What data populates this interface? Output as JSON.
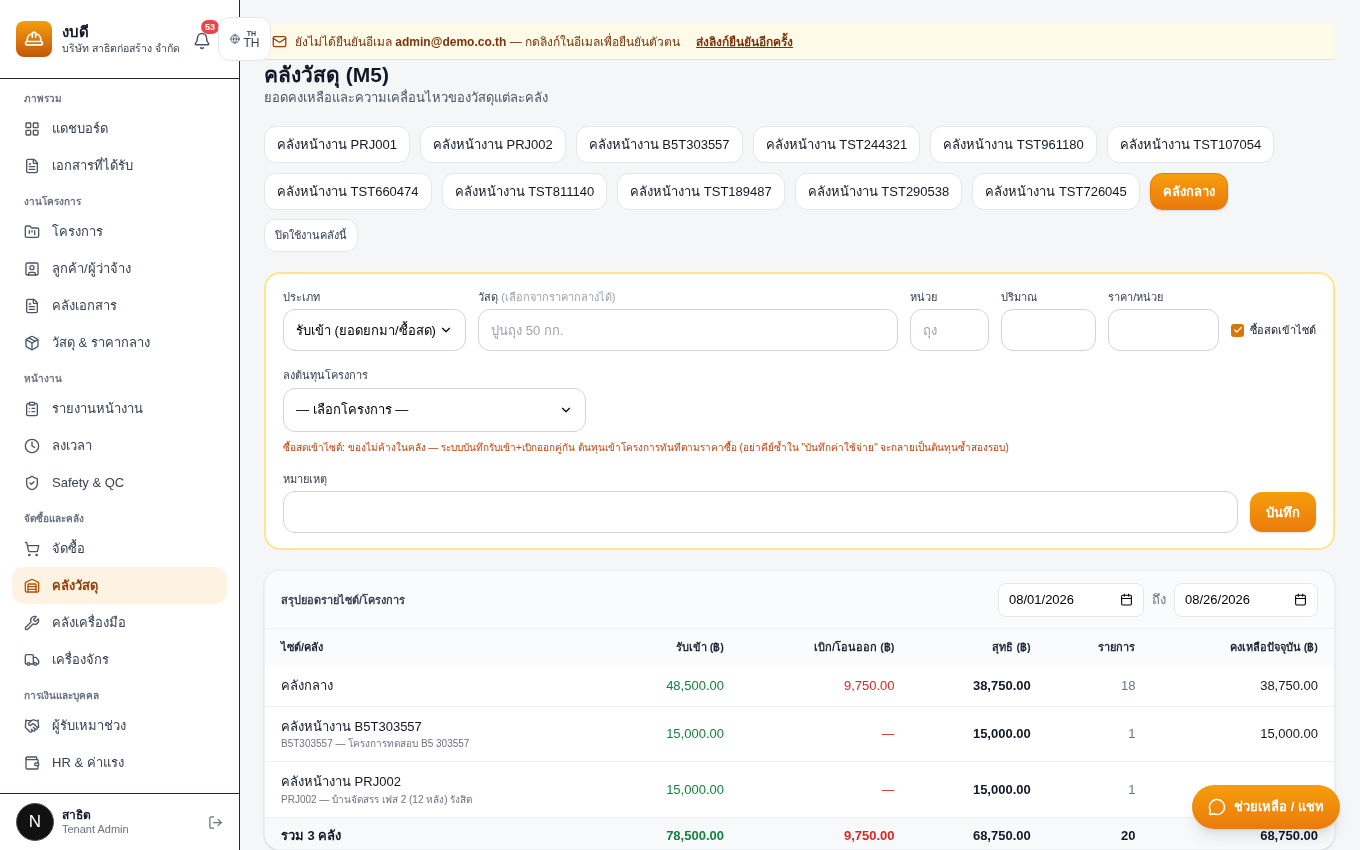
{
  "brand": {
    "name": "งบดี",
    "company": "บริษัท สาธิตก่อสร้าง จำกัด"
  },
  "notifications": {
    "count": "53"
  },
  "language": {
    "small": "TH",
    "label": "TH"
  },
  "sidebar": {
    "sections": [
      {
        "title": "ภาพรวม",
        "items": [
          {
            "label": "แดชบอร์ด",
            "selected": false
          },
          {
            "label": "เอกสารที่ได้รับ",
            "selected": false
          }
        ]
      },
      {
        "title": "งานโครงการ",
        "items": [
          {
            "label": "โครงการ",
            "selected": false
          },
          {
            "label": "ลูกค้า/ผู้ว่าจ้าง",
            "selected": false
          },
          {
            "label": "คลังเอกสาร",
            "selected": false
          },
          {
            "label": "วัสดุ & ราคากลาง",
            "selected": false
          }
        ]
      },
      {
        "title": "หน้างาน",
        "items": [
          {
            "label": "รายงานหน้างาน",
            "selected": false
          },
          {
            "label": "ลงเวลา",
            "selected": false
          },
          {
            "label": "Safety & QC",
            "selected": false
          }
        ]
      },
      {
        "title": "จัดซื้อและคลัง",
        "items": [
          {
            "label": "จัดซื้อ",
            "selected": false
          },
          {
            "label": "คลังวัสดุ",
            "selected": true
          },
          {
            "label": "คลังเครื่องมือ",
            "selected": false
          },
          {
            "label": "เครื่องจักร",
            "selected": false
          }
        ]
      },
      {
        "title": "การเงินและบุคคล",
        "items": [
          {
            "label": "ผู้รับเหมาช่วง",
            "selected": false
          },
          {
            "label": "HR & ค่าแรง",
            "selected": false
          }
        ]
      }
    ],
    "user": {
      "avatar": "N",
      "name": "สาธิต",
      "role": "Tenant Admin"
    }
  },
  "banner": {
    "text": "ยังไม่ได้ยืนยันอีเมล **admin@demo.co.th** — กดลิงก์ในอีเมลเพื่อยืนยันตัวตน",
    "link": "ส่งลิงก์ยืนยันอีกครั้ง"
  },
  "page": {
    "title": "คลังวัสดุ (M5)",
    "subtitle": "ยอดคงเหลือและความเคลื่อนไหวของวัสดุแต่ละคลัง"
  },
  "warehouses": [
    {
      "label": "คลังหน้างาน PRJ001",
      "selected": false
    },
    {
      "label": "คลังหน้างาน PRJ002",
      "selected": false
    },
    {
      "label": "คลังหน้างาน B5T303557",
      "selected": false
    },
    {
      "label": "คลังหน้างาน TST244321",
      "selected": false
    },
    {
      "label": "คลังหน้างาน TST961180",
      "selected": false
    },
    {
      "label": "คลังหน้างาน TST107054",
      "selected": false
    },
    {
      "label": "คลังหน้างาน TST660474",
      "selected": false
    },
    {
      "label": "คลังหน้างาน TST811140",
      "selected": false
    },
    {
      "label": "คลังหน้างาน TST189487",
      "selected": false
    },
    {
      "label": "คลังหน้างาน TST290538",
      "selected": false
    },
    {
      "label": "คลังหน้างาน TST726045",
      "selected": false
    },
    {
      "label": "คลังกลาง",
      "selected": true
    }
  ],
  "disable_button": "ปิดใช้งานคลังนี้",
  "form": {
    "type": {
      "label": "ประเภท",
      "value": "รับเข้า (ยอดยกมา/ซื้อสด)"
    },
    "material": {
      "label": "วัสดุ",
      "hint": "(เลือกจากราคากลางได้)",
      "placeholder": "ปูนถุง 50 กก."
    },
    "unit": {
      "label": "หน่วย",
      "placeholder": "ถุง"
    },
    "quantity": {
      "label": "ปริมาณ"
    },
    "price": {
      "label": "ราคา/หน่วย"
    },
    "direct_purchase": {
      "label": "ซื้อสดเข้าไซต์",
      "checked": true
    },
    "project": {
      "label": "ลงต้นทุนโครงการ",
      "value": "— เลือกโครงการ —"
    },
    "note": "ซื้อสดเข้าไซต์: ของไม่ค้างในคลัง — ระบบบันทึกรับเข้า+เบิกออกคู่กัน ต้นทุนเข้าโครงการทันทีตามราคาซื้อ (อย่าคีย์ซ้ำใน \"บันทึกค่าใช้จ่าย\" จะกลายเป็นต้นทุนซ้ำสองรอบ)",
    "remark": {
      "label": "หมายเหตุ"
    },
    "save": "บันทึก"
  },
  "summary": {
    "title": "สรุปยอดรายไซต์/โครงการ",
    "from": "08/01/2026",
    "to_label": "ถึง",
    "to": "08/26/2026",
    "columns": [
      "ไซต์/คลัง",
      "รับเข้า (฿)",
      "เบิก/โอนออก (฿)",
      "สุทธิ (฿)",
      "รายการ",
      "คงเหลือปัจจุบัน (฿)"
    ],
    "rows": [
      {
        "name": "คลังกลาง",
        "in": "48,500.00",
        "out": "9,750.00",
        "net": "38,750.00",
        "count": "18",
        "balance": "38,750.00"
      },
      {
        "name": "คลังหน้างาน B5T303557",
        "sub": "B5T303557 — โครงการทดสอบ B5 303557",
        "in": "15,000.00",
        "out": "—",
        "net": "15,000.00",
        "count": "1",
        "balance": "15,000.00"
      },
      {
        "name": "คลังหน้างาน PRJ002",
        "sub": "PRJ002 — บ้านจัดสรร เฟส 2 (12 หลัง) รังสิต",
        "in": "15,000.00",
        "out": "—",
        "net": "15,000.00",
        "count": "1"
      }
    ],
    "total": {
      "name": "รวม 3 คลัง",
      "in": "78,500.00",
      "out": "9,750.00",
      "net": "68,750.00",
      "count": "20",
      "balance": "68,750.00"
    }
  },
  "chat_button": "ช่วยเหลือ / แชท"
}
